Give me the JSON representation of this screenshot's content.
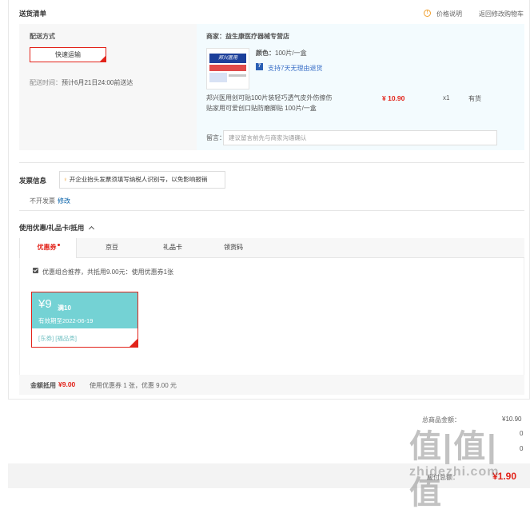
{
  "header": {
    "title": "送货清单",
    "price_info": "价格说明",
    "back_to_cart": "返回修改购物车"
  },
  "delivery": {
    "method_label": "配送方式",
    "method_button": "快速运输",
    "time_label": "配送时间：",
    "time_value": "预计6月21日24:00前送达"
  },
  "shop": {
    "label": "商家：",
    "name": "益生康医疗器械专营店"
  },
  "product": {
    "image_text": "邦兴医用",
    "color_label": "颜色：",
    "color_value": "100片/一盒",
    "return_badge": "7",
    "return_text": "支持7天无理由退货",
    "title_line1": "邦兴医用创可贴100片装轻巧透气皮外伤擦伤",
    "title_line2": "贴家用可爱创口贴防磨脚贴 100片/一盒",
    "price": "¥ 10.90",
    "quantity": "x1",
    "stock": "有货"
  },
  "note": {
    "label": "留言：",
    "placeholder": "建议留言前先与商家沟通确认"
  },
  "invoice": {
    "title": "发票信息",
    "tip": "开企业抬头发票须填写纳税人识别号，以免影响报销",
    "status": "不开发票",
    "edit": "修改"
  },
  "discount": {
    "title": "使用优惠/礼品卡/抵用",
    "tabs": [
      "优惠券",
      "京豆",
      "礼品卡",
      "领货码"
    ],
    "recommend_text": "优惠组合推荐，共抵用9.00元：使用优惠券1张",
    "coupon": {
      "amount": "¥9",
      "condition": "满10",
      "valid": "有效期至2022-06-19",
      "tags": "[东券]  [福品类]"
    },
    "summary_label": "金额抵用",
    "summary_amount": "¥9.00",
    "summary_detail": "使用优惠券 1 张，优惠 9.00 元"
  },
  "totals": {
    "total_label": "总商品金额：",
    "total_value": "¥10.90",
    "row2_value": "0",
    "row3_value": "0",
    "payable_label": "应付总额：",
    "payable_value": "¥1.90"
  },
  "watermark": {
    "main": "值|值|值",
    "sub": "zhidezhi.com"
  },
  "colors": {
    "accent_red": "#e2231a",
    "coupon_teal": "#74d2d4",
    "link_blue": "#005ea7"
  }
}
